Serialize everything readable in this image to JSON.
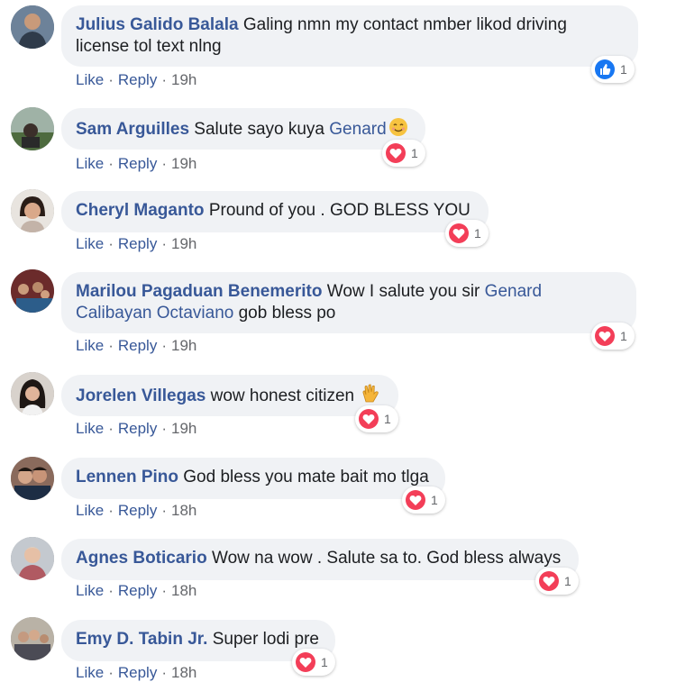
{
  "comments": [
    {
      "author": "Julius Galido Balala",
      "text": "Galing nmn my contact nmber likod driving license tol text nlng",
      "reaction": {
        "type": "like",
        "count": "1"
      },
      "like_label": "Like",
      "reply_label": "Reply",
      "time": "19h"
    },
    {
      "author": "Sam Arguilles",
      "text": "Salute sayo kuya",
      "mention": "Genard",
      "emoji": "smile-emoji",
      "reaction": {
        "type": "love",
        "count": "1"
      },
      "like_label": "Like",
      "reply_label": "Reply",
      "time": "19h"
    },
    {
      "author": "Cheryl Maganto",
      "text": "Pround of you . GOD BLESS YOU",
      "reaction": {
        "type": "love",
        "count": "1"
      },
      "like_label": "Like",
      "reply_label": "Reply",
      "time": "19h"
    },
    {
      "author": "Marilou Pagaduan Benemerito",
      "text_before": "Wow I salute you sir",
      "mention": "Genard Calibayan Octaviano",
      "text_after": "gob bless po",
      "reaction": {
        "type": "love",
        "count": "1"
      },
      "like_label": "Like",
      "reply_label": "Reply",
      "time": "19h"
    },
    {
      "author": "Jorelen Villegas",
      "text": "wow honest citizen",
      "emoji": "clap-emoji",
      "reaction": {
        "type": "love",
        "count": "1"
      },
      "like_label": "Like",
      "reply_label": "Reply",
      "time": "19h"
    },
    {
      "author": "Lennen Pino",
      "text": "God bless you mate bait mo tlga",
      "reaction": {
        "type": "love",
        "count": "1"
      },
      "like_label": "Like",
      "reply_label": "Reply",
      "time": "18h"
    },
    {
      "author": "Agnes Boticario",
      "text": "Wow na wow . Salute sa to. God bless always",
      "reaction": {
        "type": "love",
        "count": "1"
      },
      "like_label": "Like",
      "reply_label": "Reply",
      "time": "18h"
    },
    {
      "author": "Emy D. Tabin Jr.",
      "text": "Super lodi pre",
      "reaction": {
        "type": "love",
        "count": "1"
      },
      "like_label": "Like",
      "reply_label": "Reply",
      "time": "18h"
    }
  ],
  "colors": {
    "link": "#385898",
    "bubble": "#f0f2f5",
    "love": "#f33e58",
    "like": "#1877f2",
    "meta": "#65676b"
  }
}
